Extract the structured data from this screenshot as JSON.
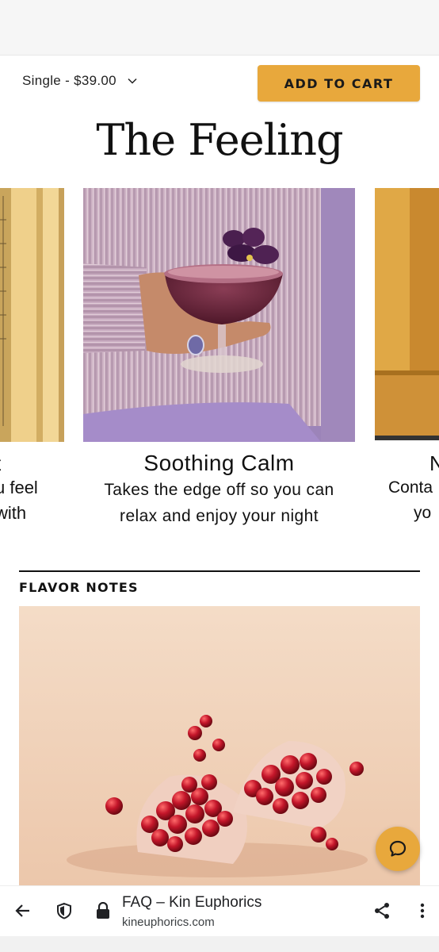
{
  "buybar": {
    "variant_label": "Single - $39.00",
    "add_to_cart_label": "ADD TO CART",
    "accent_color": "#e8a83c"
  },
  "section": {
    "title": "The Feeling"
  },
  "carousel": {
    "slides": [
      {
        "head": "t",
        "desc_lines": [
          "u feel",
          "with"
        ]
      },
      {
        "head": "Soothing Calm",
        "desc": "Takes the edge off so you can relax and enjoy your night"
      },
      {
        "head": "N",
        "desc_lines": [
          "Conta",
          "yo"
        ]
      }
    ]
  },
  "flavor": {
    "label": "FLAVOR NOTES"
  },
  "chat": {
    "icon": "chat-bubble-icon"
  },
  "browser": {
    "page_title": "FAQ – Kin Euphorics",
    "url": "kineuphorics.com",
    "icons": [
      "back-arrow-icon",
      "shield-icon",
      "lock-icon",
      "share-icon",
      "more-vert-icon"
    ]
  }
}
